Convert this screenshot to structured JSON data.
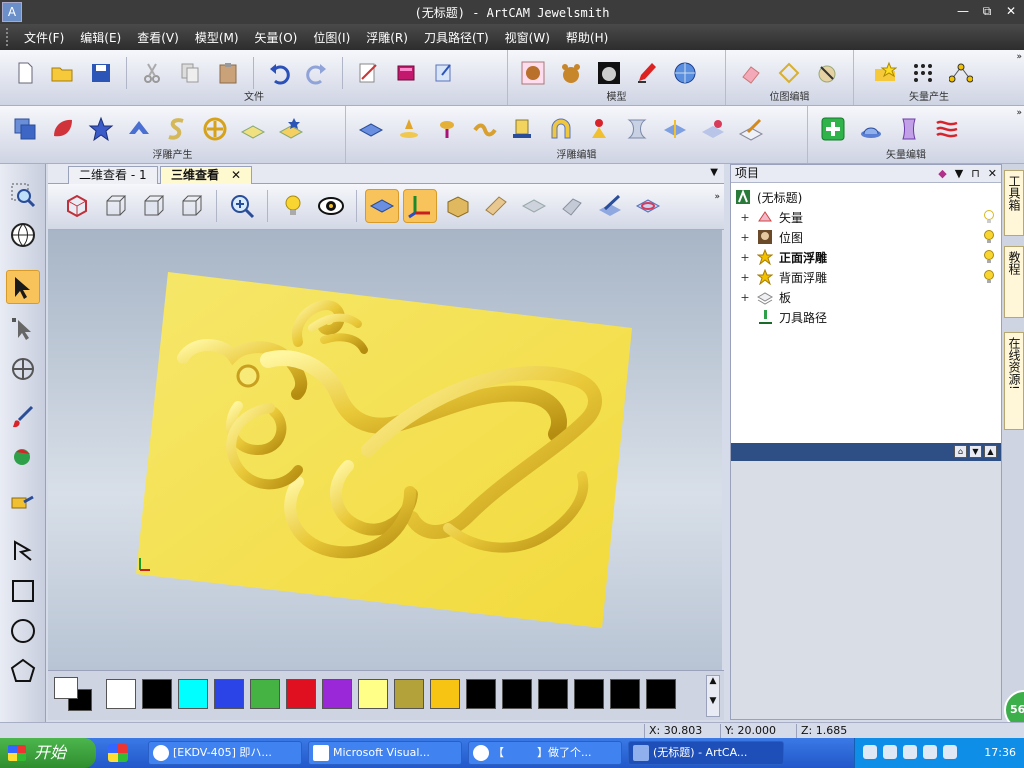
{
  "window": {
    "title": "(无标题) - ArtCAM Jewelsmith",
    "minimize": "—",
    "restore": "⧉",
    "close": "✕",
    "app_icon": "A"
  },
  "menu": [
    "文件(F)",
    "编辑(E)",
    "查看(V)",
    "模型(M)",
    "矢量(O)",
    "位图(I)",
    "浮雕(R)",
    "刀具路径(T)",
    "视窗(W)",
    "帮助(H)"
  ],
  "toolbar_groups": {
    "file": "文件",
    "model": "模型",
    "bitmap_edit": "位图编辑",
    "vector_create": "矢量产生",
    "relief_create": "浮雕产生",
    "relief_edit": "浮雕编辑",
    "vector_edit": "矢量编辑"
  },
  "tabs": {
    "tab1": "二维查看 - 1",
    "tab2": "三维查看",
    "close": "✕",
    "dropdown": "▼"
  },
  "project_panel": {
    "title": "项目",
    "controls": [
      "◆",
      "▼",
      "⊓",
      "✕"
    ],
    "tree": [
      {
        "label": "(无标题)",
        "expand": "",
        "icon": "artcam-icon",
        "bold": false
      },
      {
        "label": "矢量",
        "expand": "+",
        "icon": "vector-icon",
        "bold": false
      },
      {
        "label": "位图",
        "expand": "+",
        "icon": "bitmap-icon",
        "bold": false
      },
      {
        "label": "正面浮雕",
        "expand": "+",
        "icon": "relief-icon",
        "bold": true
      },
      {
        "label": "背面浮雕",
        "expand": "+",
        "icon": "relief-icon",
        "bold": false
      },
      {
        "label": "板",
        "expand": "+",
        "icon": "layer-icon",
        "bold": false
      },
      {
        "label": "刀具路径",
        "expand": "",
        "icon": "toolpath-icon",
        "bold": false
      }
    ]
  },
  "side_tabs": [
    "工具箱",
    "教程",
    "在线资源!"
  ],
  "badge": "56",
  "status": {
    "x": "X: 30.803",
    "y": "Y: 20.000",
    "z": "Z: 1.685"
  },
  "taskbar": {
    "start": "开始",
    "items": [
      "[EKDV-405] 即ハ...",
      "Microsoft Visual...",
      "【　　　】做了个...",
      "(无标题) - ArtCA..."
    ],
    "clock": "17:36"
  },
  "colors": {
    "relief_gold": "#f4e05a",
    "selected": "#f8c35a",
    "panel_header": "#2e4f85"
  },
  "palette": [
    "#ffffff",
    "#000000",
    "#00ffff",
    "#2a44e8",
    "#45b244",
    "#e01020",
    "#9b28d8",
    "#ffff88",
    "#b3a23a",
    "#f7c414",
    "#000000",
    "#000000",
    "#000000",
    "#000000",
    "#000000",
    "#000000"
  ]
}
